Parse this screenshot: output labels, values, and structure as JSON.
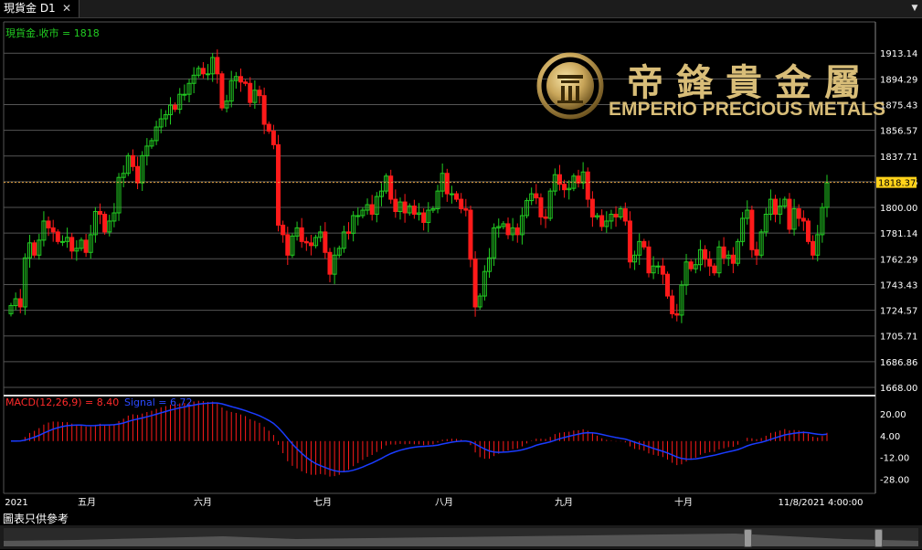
{
  "window": {
    "tab_title": "現貨金 D1",
    "close_glyph": "✕",
    "menu_glyph": "▼"
  },
  "chart_header": {
    "price_label": "現貨金.收市 = 1818",
    "macd_label": "MACD(12,26,9) = 8.40",
    "signal_label": "Signal = 6.72"
  },
  "brand": {
    "chinese_name": "帝鋒貴金屬",
    "english_name": "EMPERIO PRECIOUS METALS"
  },
  "footer": {
    "disclaimer": "圖表只供參考"
  },
  "colors": {
    "bull": "#22cc22",
    "bear": "#ff1a1a",
    "current_price_line": "#e6a23c",
    "macd_hist": "#ff1a1a",
    "signal_line": "#1a3cff",
    "grid": "#555555",
    "axis_text": "#ffffff",
    "gold": "#c9a65a"
  },
  "chart_data": [
    {
      "type": "candlestick",
      "title": "現貨金.收市 = 1818",
      "ylim": [
        1668.0,
        1922.0
      ],
      "y_ticks": [
        "1913.14",
        "1894.29",
        "1875.43",
        "1856.57",
        "1837.71",
        "1818.86",
        "1800.00",
        "1781.14",
        "1762.29",
        "1743.43",
        "1724.57",
        "1705.71",
        "1686.86",
        "1668.00"
      ],
      "current_price": "1818.37",
      "x_labels": [
        "2021",
        "五月",
        "六月",
        "七月",
        "八月",
        "九月",
        "十月",
        "11/8/2021 4:00:00"
      ],
      "closes": [
        1728,
        1733,
        1727,
        1763,
        1774,
        1765,
        1776,
        1790,
        1785,
        1782,
        1775,
        1775,
        1778,
        1768,
        1770,
        1776,
        1767,
        1780,
        1797,
        1795,
        1782,
        1790,
        1796,
        1822,
        1825,
        1838,
        1830,
        1818,
        1838,
        1845,
        1849,
        1859,
        1865,
        1868,
        1875,
        1872,
        1883,
        1883,
        1891,
        1897,
        1902,
        1898,
        1898,
        1910,
        1898,
        1873,
        1878,
        1893,
        1896,
        1892,
        1891,
        1877,
        1886,
        1882,
        1861,
        1856,
        1846,
        1787,
        1780,
        1765,
        1779,
        1785,
        1775,
        1774,
        1772,
        1778,
        1782,
        1767,
        1751,
        1765,
        1770,
        1782,
        1781,
        1794,
        1794,
        1798,
        1802,
        1795,
        1808,
        1812,
        1823,
        1806,
        1797,
        1804,
        1796,
        1801,
        1795,
        1796,
        1789,
        1798,
        1799,
        1812,
        1825,
        1810,
        1810,
        1806,
        1799,
        1798,
        1762,
        1727,
        1735,
        1753,
        1763,
        1785,
        1786,
        1788,
        1780,
        1785,
        1780,
        1794,
        1805,
        1810,
        1807,
        1793,
        1792,
        1812,
        1824,
        1817,
        1813,
        1814,
        1823,
        1818,
        1826,
        1806,
        1793,
        1794,
        1786,
        1790,
        1795,
        1793,
        1799,
        1790,
        1760,
        1765,
        1775,
        1771,
        1752,
        1757,
        1757,
        1751,
        1735,
        1722,
        1721,
        1743,
        1760,
        1755,
        1758,
        1769,
        1762,
        1757,
        1752,
        1771,
        1763,
        1765,
        1759,
        1775,
        1792,
        1798,
        1769,
        1765,
        1782,
        1795,
        1806,
        1795,
        1801,
        1806,
        1784,
        1799,
        1792,
        1790,
        1775,
        1765,
        1780,
        1800,
        1818
      ],
      "macd_ylim": [
        -33.0,
        26.0
      ],
      "macd_ticks": [
        "20.00",
        "4.00",
        "-12.00",
        "-28.00"
      ]
    }
  ]
}
